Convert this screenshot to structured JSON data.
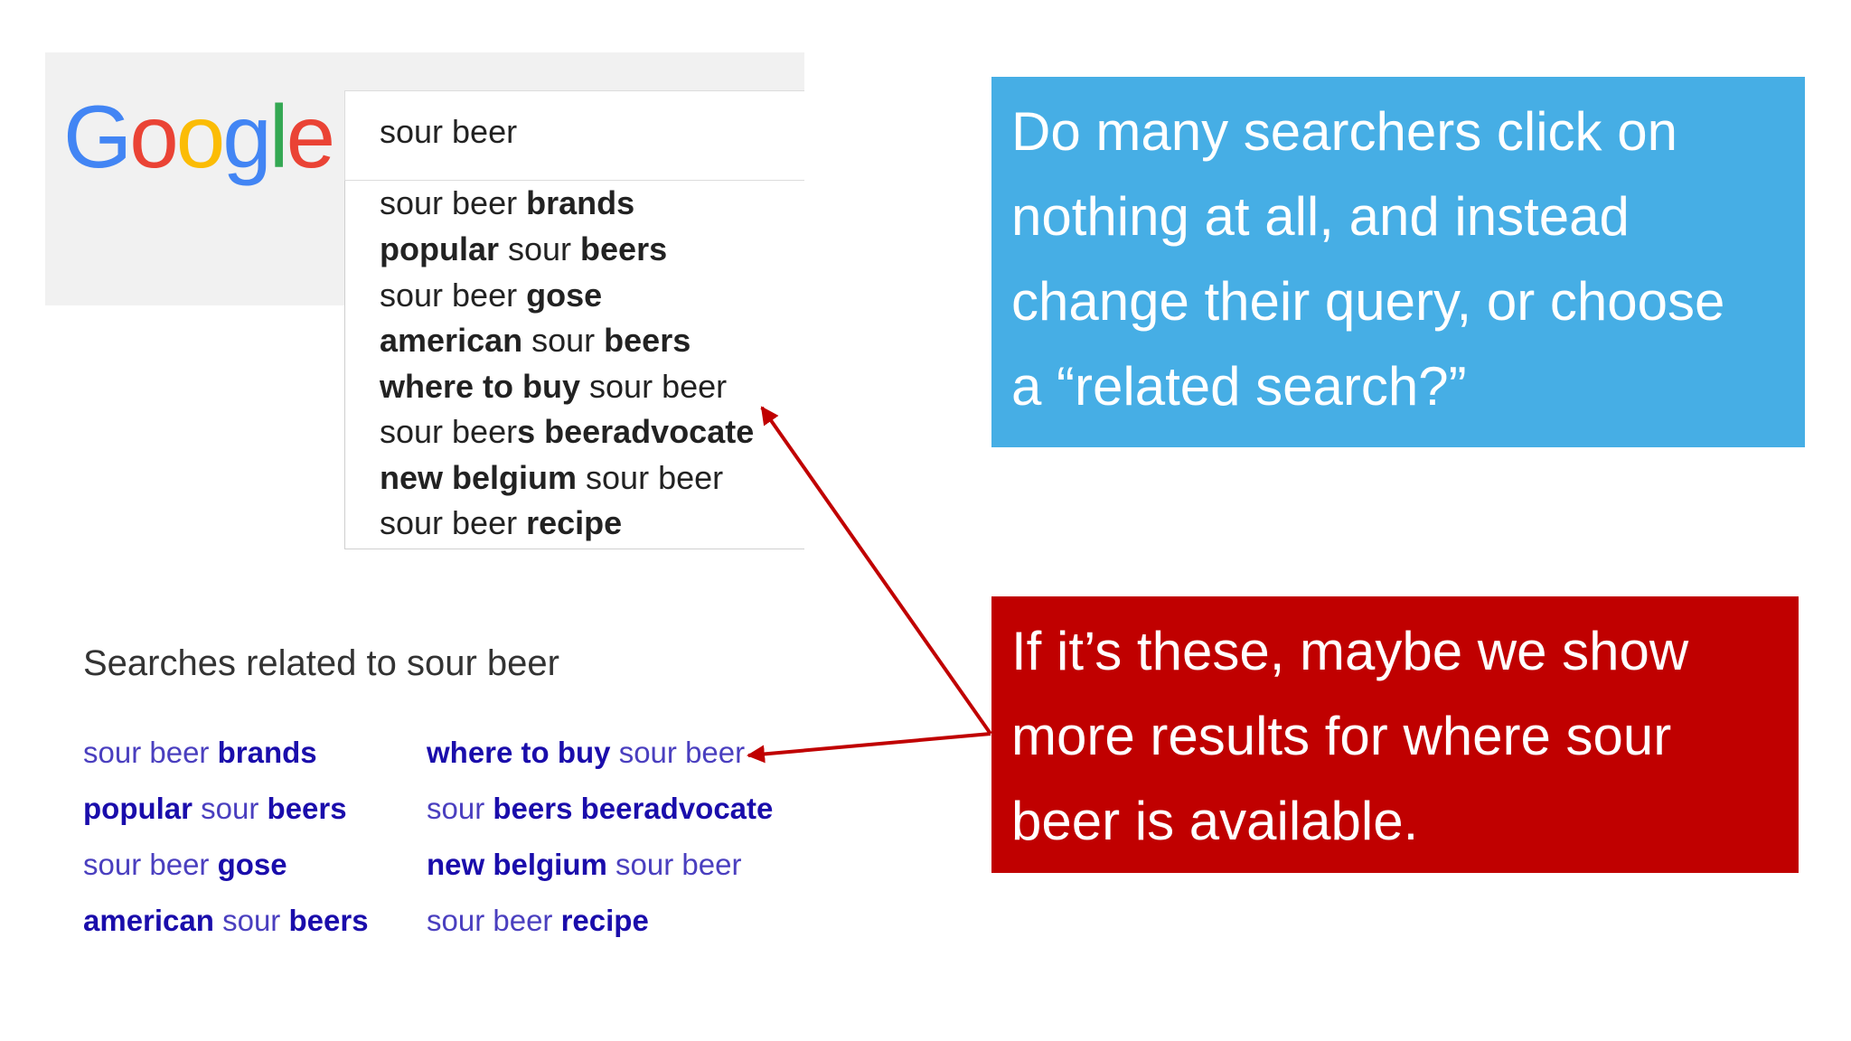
{
  "logo": {
    "letters": [
      "G",
      "o",
      "o",
      "g",
      "l",
      "e"
    ],
    "colors": [
      "#4285F4",
      "#EA4335",
      "#FBBC05",
      "#4285F4",
      "#34A853",
      "#EA4335"
    ]
  },
  "search": {
    "query": "sour beer"
  },
  "suggestions": [
    {
      "parts": [
        {
          "t": "sour beer ",
          "b": false
        },
        {
          "t": "brands",
          "b": true
        }
      ]
    },
    {
      "parts": [
        {
          "t": "popular",
          "b": true
        },
        {
          "t": " sour ",
          "b": false
        },
        {
          "t": "beers",
          "b": true
        }
      ]
    },
    {
      "parts": [
        {
          "t": "sour beer ",
          "b": false
        },
        {
          "t": "gose",
          "b": true
        }
      ]
    },
    {
      "parts": [
        {
          "t": "american",
          "b": true
        },
        {
          "t": " sour ",
          "b": false
        },
        {
          "t": "beers",
          "b": true
        }
      ]
    },
    {
      "parts": [
        {
          "t": "where to buy",
          "b": true
        },
        {
          "t": " sour beer",
          "b": false
        }
      ]
    },
    {
      "parts": [
        {
          "t": "sour beer",
          "b": false
        },
        {
          "t": "s beeradvocate",
          "b": true
        }
      ]
    },
    {
      "parts": [
        {
          "t": "new belgium",
          "b": true
        },
        {
          "t": " sour beer",
          "b": false
        }
      ]
    },
    {
      "parts": [
        {
          "t": "sour beer ",
          "b": false
        },
        {
          "t": "recipe",
          "b": true
        }
      ]
    }
  ],
  "related": {
    "title": "Searches related to sour beer",
    "links": [
      {
        "parts": [
          {
            "t": "sour beer ",
            "b": false
          },
          {
            "t": "brands",
            "b": true
          }
        ]
      },
      {
        "parts": [
          {
            "t": "where to buy",
            "b": true
          },
          {
            "t": " sour beer",
            "b": false
          }
        ]
      },
      {
        "parts": [
          {
            "t": "popular",
            "b": true
          },
          {
            "t": " sour ",
            "b": false
          },
          {
            "t": "beers",
            "b": true
          }
        ]
      },
      {
        "parts": [
          {
            "t": "sour ",
            "b": false
          },
          {
            "t": "beers beeradvocate",
            "b": true
          }
        ]
      },
      {
        "parts": [
          {
            "t": "sour beer ",
            "b": false
          },
          {
            "t": "gose",
            "b": true
          }
        ]
      },
      {
        "parts": [
          {
            "t": "new belgium",
            "b": true
          },
          {
            "t": " sour beer",
            "b": false
          }
        ]
      },
      {
        "parts": [
          {
            "t": "american",
            "b": true
          },
          {
            "t": " sour ",
            "b": false
          },
          {
            "t": "beers",
            "b": true
          }
        ]
      },
      {
        "parts": [
          {
            "t": "sour beer ",
            "b": false
          },
          {
            "t": "recipe",
            "b": true
          }
        ]
      }
    ]
  },
  "callout_blue": {
    "lines": [
      "Do many searchers click on",
      "nothing at all, and instead",
      "change their query, or choose",
      "a “related search?”"
    ],
    "color": "#46aee5"
  },
  "callout_red": {
    "lines": [
      "If it’s these, maybe we show",
      "more results for where sour",
      "beer is available."
    ],
    "color": "#c00000"
  },
  "arrow_color": "#c00000"
}
